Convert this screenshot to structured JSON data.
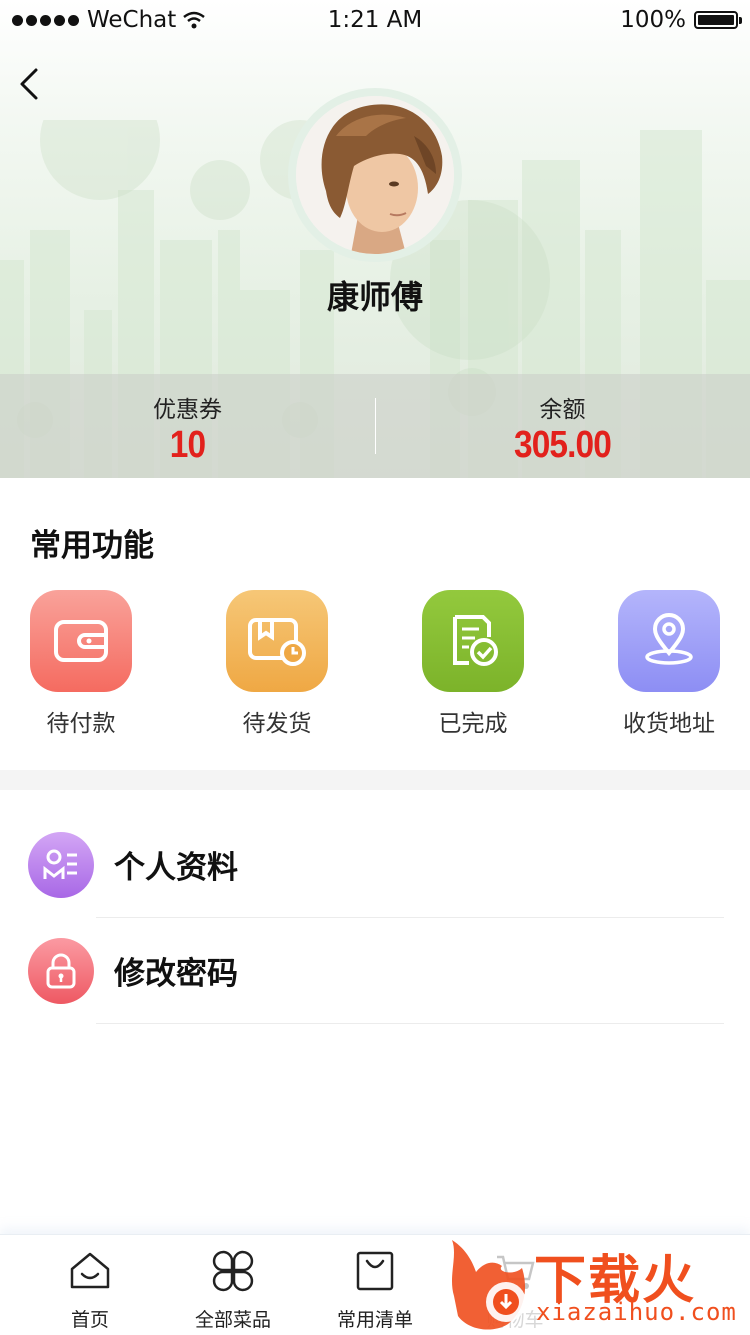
{
  "status_bar": {
    "carrier": "WeChat",
    "time": "1:21 AM",
    "battery": "100%"
  },
  "profile": {
    "name": "康师傅"
  },
  "stats": {
    "coupon_label": "优惠券",
    "coupon_value": "10",
    "balance_label": "余额",
    "balance_value": "305.00"
  },
  "functions": {
    "title": "常用功能",
    "items": [
      {
        "label": "待付款",
        "icon": "wallet-icon",
        "color_from": "#f9a29a",
        "color_to": "#f56b60"
      },
      {
        "label": "待发货",
        "icon": "package-clock-icon",
        "color_from": "#f6c777",
        "color_to": "#efa844"
      },
      {
        "label": "已完成",
        "icon": "document-check-icon",
        "color_from": "#93c93d",
        "color_to": "#7cb32a"
      },
      {
        "label": "收货地址",
        "icon": "location-pin-icon",
        "color_from": "#b4b5fb",
        "color_to": "#8d8ef4"
      }
    ]
  },
  "menu": {
    "items": [
      {
        "label": "个人资料",
        "icon": "profile-card-icon",
        "color_from": "#d3a6f5",
        "color_to": "#a868e6"
      },
      {
        "label": "修改密码",
        "icon": "lock-icon",
        "color_from": "#fb9aa2",
        "color_to": "#ee5963"
      }
    ]
  },
  "tabbar": {
    "items": [
      {
        "label": "首页",
        "icon": "home-icon"
      },
      {
        "label": "全部菜品",
        "icon": "grid-petals-icon"
      },
      {
        "label": "常用清单",
        "icon": "shopping-bag-icon"
      },
      {
        "label": "购物车",
        "icon": "cart-icon"
      }
    ]
  },
  "watermark": {
    "title": "下载火",
    "url": "xiazaihuo.com"
  }
}
